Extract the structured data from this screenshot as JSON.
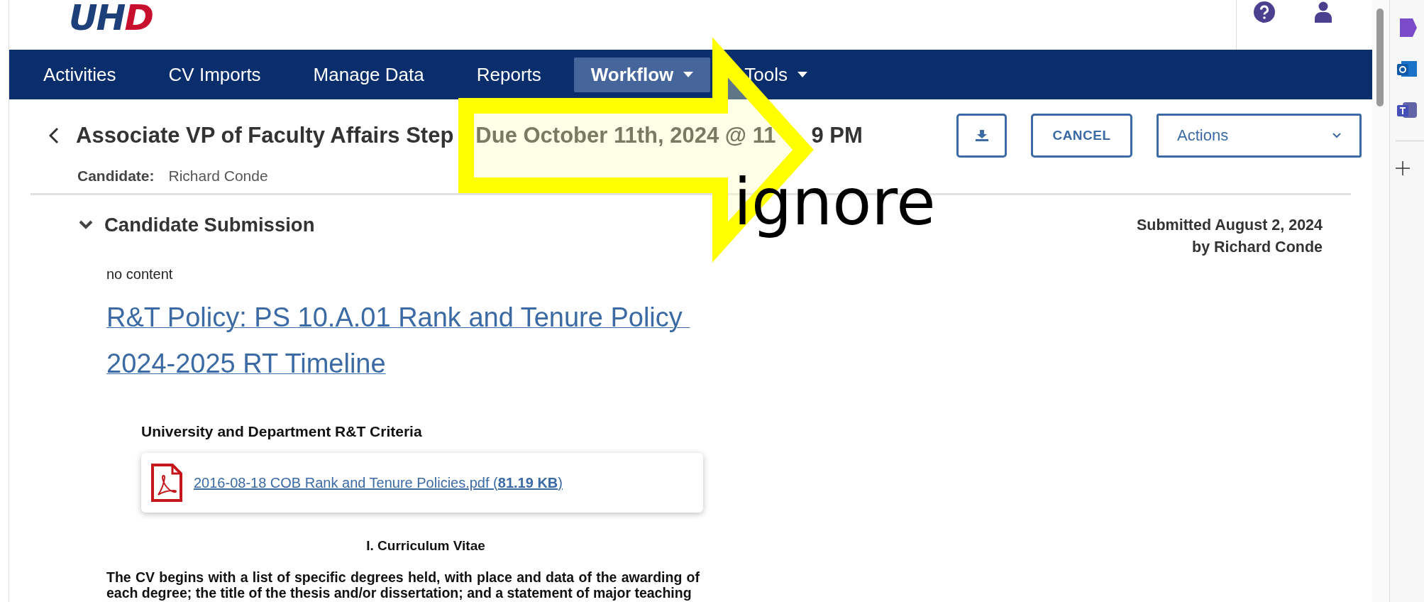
{
  "logo": {
    "parts": [
      {
        "text": "UH",
        "color": "#1d3f7a"
      },
      {
        "text": "D",
        "color": "#c8102e"
      }
    ]
  },
  "nav": [
    {
      "label": "Activities",
      "selected": false,
      "dropdown": false
    },
    {
      "label": "CV Imports",
      "selected": false,
      "dropdown": false
    },
    {
      "label": "Manage Data",
      "selected": false,
      "dropdown": false
    },
    {
      "label": "Reports",
      "selected": false,
      "dropdown": false
    },
    {
      "label": "Workflow",
      "selected": true,
      "dropdown": true
    },
    {
      "label": "Tools",
      "selected": false,
      "dropdown": true
    }
  ],
  "header": {
    "title": "Associate VP of Faculty Affairs Step",
    "due_before": "Due October 11th, 2024 @ 11",
    "due_after": "9 PM",
    "candidate_label": "Candidate:",
    "candidate_name": "Richard Conde",
    "cancel_button": "CANCEL",
    "actions_select": "Actions"
  },
  "section": {
    "title": "Candidate Submission",
    "expanded": true,
    "submitted": "Submitted August 2, 2024",
    "submitted_by": "by Richard Conde",
    "note": "no content",
    "links": [
      "R&T Policy: PS 10.A.01 Rank and Tenure Policy ",
      "2024-2025 RT Timeline"
    ],
    "criteria_heading": "University and Department R&T Criteria",
    "file": {
      "name": "2016-08-18 COB Rank and Tenure Policies.pdf (",
      "size": "81.19 KB",
      "close": ")"
    },
    "cv_heading": "I. Curriculum Vitae",
    "cv_text": "The CV begins with a list of specific degrees held, with place and data of the awarding of each degree; the title of the thesis and/or dissertation; and a statement of major teaching"
  },
  "annotation": {
    "text": "ignore"
  }
}
